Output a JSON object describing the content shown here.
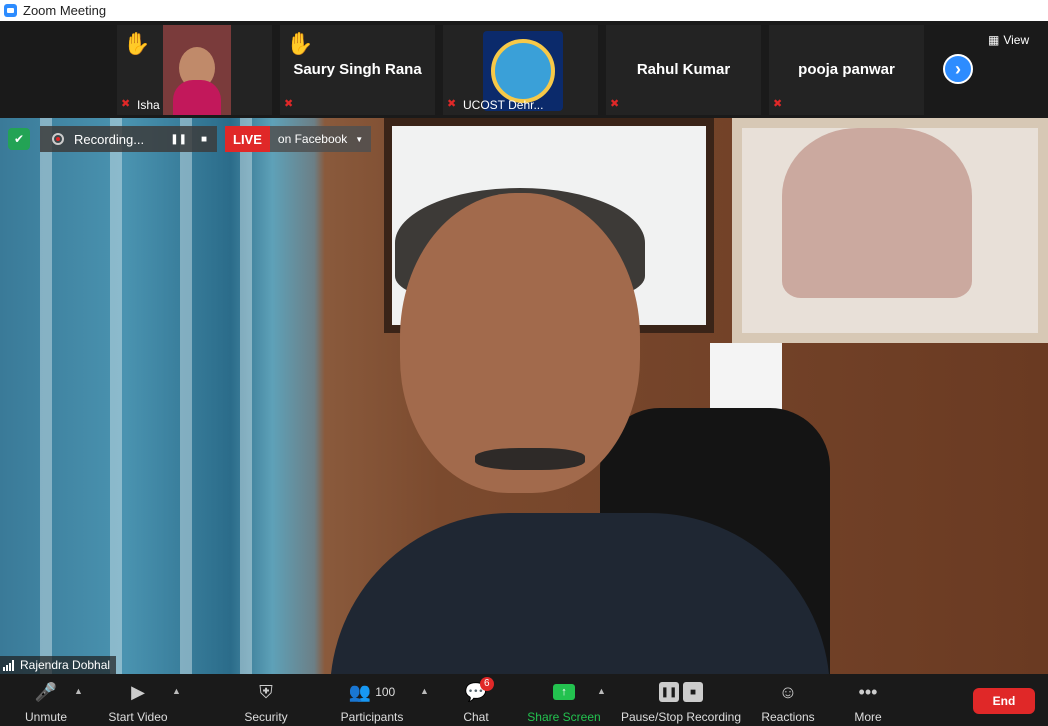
{
  "window": {
    "title": "Zoom Meeting"
  },
  "participants_strip": [
    {
      "name": "",
      "label": "Isha",
      "hand_raised": true,
      "muted": true,
      "has_video": true
    },
    {
      "name": "Saury Singh Rana",
      "label": "",
      "hand_raised": true,
      "muted": true,
      "has_video": false
    },
    {
      "name": "",
      "label": "UCOST Dehr...",
      "hand_raised": false,
      "muted": true,
      "has_video": true
    },
    {
      "name": "Rahul Kumar",
      "label": "",
      "hand_raised": false,
      "muted": true,
      "has_video": false
    },
    {
      "name": "pooja panwar",
      "label": "",
      "hand_raised": false,
      "muted": true,
      "has_video": false
    }
  ],
  "view_button": "View",
  "recording": {
    "label": "Recording..."
  },
  "live": {
    "badge": "LIVE",
    "platform": "on Facebook"
  },
  "speaker": {
    "name": "Rajendra Dobhal"
  },
  "toolbar": {
    "unmute": "Unmute",
    "start_video": "Start Video",
    "security": "Security",
    "participants": "Participants",
    "participants_count": "100",
    "chat": "Chat",
    "chat_badge": "6",
    "share_screen": "Share Screen",
    "pause_stop_recording": "Pause/Stop Recording",
    "reactions": "Reactions",
    "more": "More",
    "end": "End"
  },
  "colors": {
    "accent": "#2d8cff",
    "danger": "#e02828",
    "share": "#23c24f",
    "hand": "#f2c33b"
  }
}
